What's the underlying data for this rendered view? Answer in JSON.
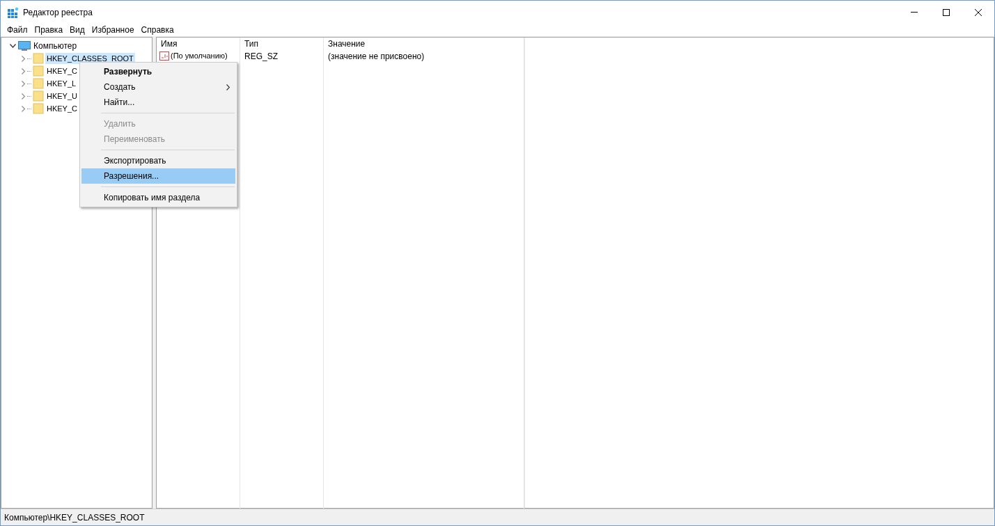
{
  "window": {
    "title": "Редактор реестра"
  },
  "menu_bar": [
    "Файл",
    "Правка",
    "Вид",
    "Избранное",
    "Справка"
  ],
  "tree": {
    "label": "Компьютер",
    "expanded": true,
    "children": [
      {
        "label": "HKEY_CLASSES_ROOT",
        "selected": true,
        "expanded": false
      },
      {
        "label": "HKEY_C",
        "selected": false,
        "expanded": false
      },
      {
        "label": "HKEY_L",
        "selected": false,
        "expanded": false
      },
      {
        "label": "HKEY_U",
        "selected": false,
        "expanded": false
      },
      {
        "label": "HKEY_C",
        "selected": false,
        "expanded": false
      }
    ]
  },
  "table": {
    "columns": [
      "Имя",
      "Тип",
      "Значение"
    ],
    "rows": [
      [
        "(По умолчанию)",
        "REG_SZ",
        "(значение не присвоено)"
      ]
    ]
  },
  "context_menu": [
    {
      "kind": "item",
      "label": "Развернуть",
      "bold": true,
      "disabled": false,
      "selected": false
    },
    {
      "kind": "submenu",
      "label": "Создать",
      "bold": false,
      "disabled": false,
      "selected": false
    },
    {
      "kind": "item",
      "label": "Найти...",
      "bold": false,
      "disabled": false,
      "selected": false
    },
    {
      "kind": "separator"
    },
    {
      "kind": "item",
      "label": "Удалить",
      "bold": false,
      "disabled": true,
      "selected": false
    },
    {
      "kind": "item",
      "label": "Переименовать",
      "bold": false,
      "disabled": true,
      "selected": false
    },
    {
      "kind": "separator"
    },
    {
      "kind": "item",
      "label": "Экспортировать",
      "bold": false,
      "disabled": false,
      "selected": false
    },
    {
      "kind": "item",
      "label": "Разрешения...",
      "bold": false,
      "disabled": false,
      "selected": true
    },
    {
      "kind": "separator"
    },
    {
      "kind": "item",
      "label": "Копировать имя раздела",
      "bold": false,
      "disabled": false,
      "selected": false
    }
  ],
  "status_bar": "Компьютер\\HKEY_CLASSES_ROOT"
}
